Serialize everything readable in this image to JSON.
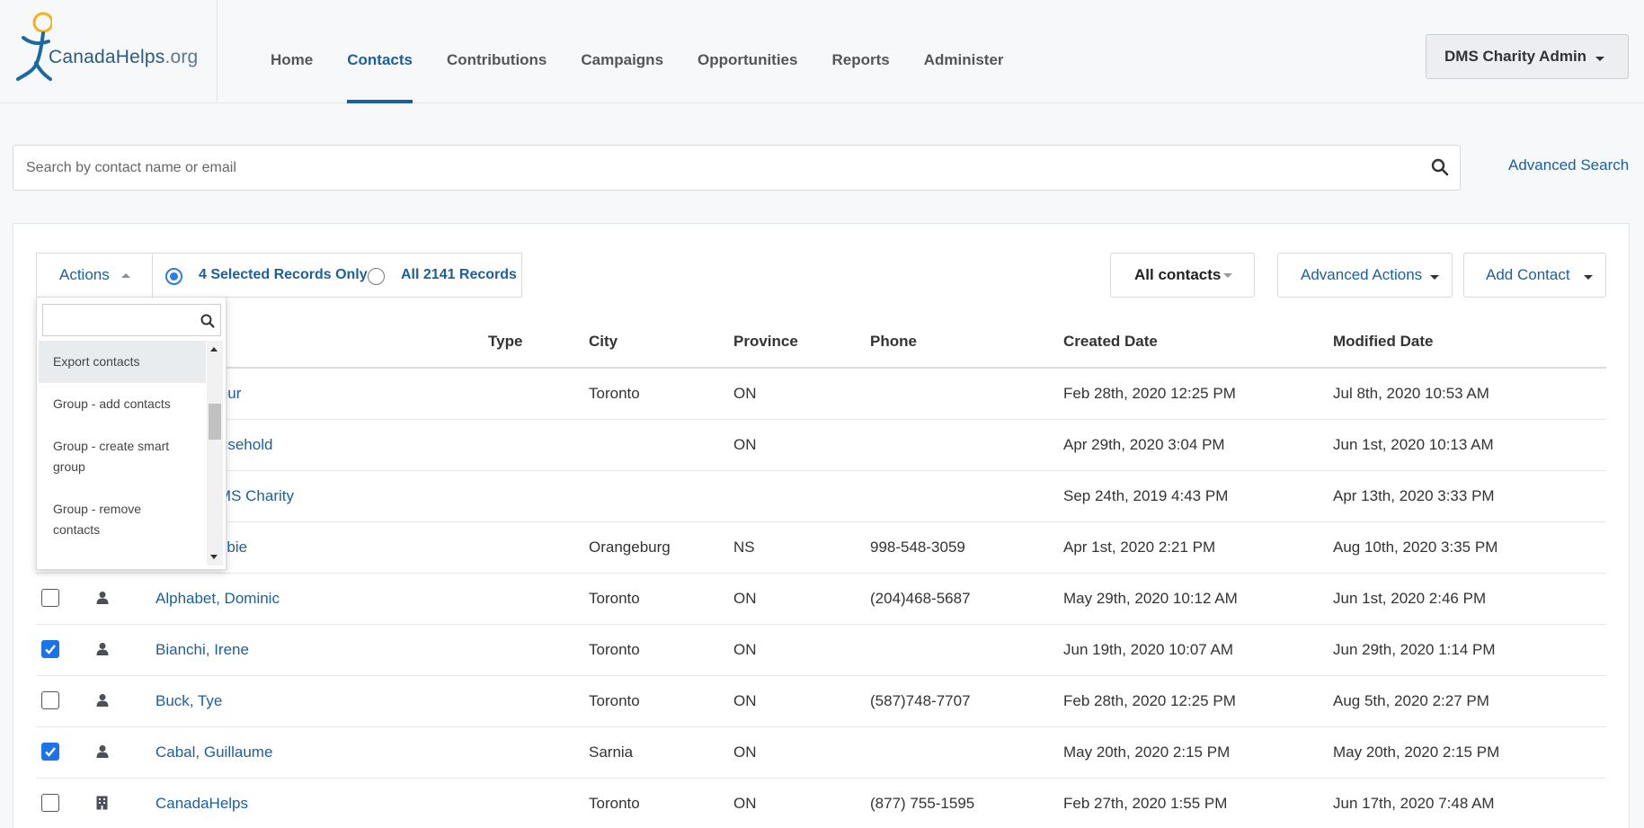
{
  "logo": {
    "text_main": "CanadaHelps",
    "text_suffix": ".org"
  },
  "nav": [
    {
      "label": "Home",
      "active": false
    },
    {
      "label": "Contacts",
      "active": true
    },
    {
      "label": "Contributions",
      "active": false
    },
    {
      "label": "Campaigns",
      "active": false
    },
    {
      "label": "Opportunities",
      "active": false
    },
    {
      "label": "Reports",
      "active": false
    },
    {
      "label": "Administer",
      "active": false
    }
  ],
  "user_menu": {
    "label": "DMS Charity Admin"
  },
  "search": {
    "placeholder": "Search by contact name or email",
    "value": "",
    "icon": "search-icon"
  },
  "advanced_search": "Advanced Search",
  "toolbar": {
    "actions_label": "Actions",
    "selected_records_label": "4 Selected Records Only",
    "all_records_label": "All 2141 Records",
    "selected_option": "selected",
    "filter_label": "All contacts",
    "advanced_actions_label": "Advanced Actions",
    "add_contact_label": "Add Contact"
  },
  "actions_dropdown": {
    "search_placeholder": "",
    "items": [
      "Export contacts",
      "Group - add contacts",
      "Group - create smart group",
      "Group - remove contacts"
    ]
  },
  "table": {
    "columns": {
      "type": "Type",
      "city": "City",
      "province": "Province",
      "phone": "Phone",
      "created": "Created Date",
      "modified": "Modified Date"
    },
    "rows": [
      {
        "checked": false,
        "type_icon": "person-icon",
        "name": "Abdul, Omur",
        "city": "Toronto",
        "province": "ON",
        "phone": "",
        "created": "Feb 28th, 2020 12:25 PM",
        "modified": "Jul 8th, 2020 10:53 AM"
      },
      {
        "checked": false,
        "type_icon": "household-icon",
        "name": "Abbot Household",
        "city": "",
        "province": "ON",
        "phone": "",
        "created": "Apr 29th, 2020 3:04 PM",
        "modified": "Jun 1st, 2020 10:13 AM"
      },
      {
        "checked": false,
        "type_icon": "organization-icon",
        "name": "Admin, DMS Charity",
        "city": "",
        "province": "",
        "phone": "",
        "created": "Sep 24th, 2019 4:43 PM",
        "modified": "Apr 13th, 2020 3:33 PM"
      },
      {
        "checked": false,
        "type_icon": "person-icon",
        "name": "Allison, Abbie",
        "city": "Orangeburg",
        "province": "NS",
        "phone": "998-548-3059",
        "created": "Apr 1st, 2020 2:21 PM",
        "modified": "Aug 10th, 2020 3:35 PM"
      },
      {
        "checked": false,
        "type_icon": "person-icon",
        "name": "Alphabet, Dominic",
        "city": "Toronto",
        "province": "ON",
        "phone": "(204)468-5687",
        "created": "May 29th, 2020 10:12 AM",
        "modified": "Jun 1st, 2020 2:46 PM"
      },
      {
        "checked": true,
        "type_icon": "person-icon",
        "name": "Bianchi, Irene",
        "city": "Toronto",
        "province": "ON",
        "phone": "",
        "created": "Jun 19th, 2020 10:07 AM",
        "modified": "Jun 29th, 2020 1:14 PM"
      },
      {
        "checked": false,
        "type_icon": "person-icon",
        "name": "Buck, Tye",
        "city": "Toronto",
        "province": "ON",
        "phone": "(587)748-7707",
        "created": "Feb 28th, 2020 12:25 PM",
        "modified": "Aug 5th, 2020 2:27 PM"
      },
      {
        "checked": true,
        "type_icon": "person-icon",
        "name": "Cabal, Guillaume",
        "city": "Sarnia",
        "province": "ON",
        "phone": "",
        "created": "May 20th, 2020 2:15 PM",
        "modified": "May 20th, 2020 2:15 PM"
      },
      {
        "checked": false,
        "type_icon": "building-icon",
        "name": "CanadaHelps",
        "city": "Toronto",
        "province": "ON",
        "phone": "(877) 755-1595",
        "created": "Feb 27th, 2020 1:55 PM",
        "modified": "Jun 17th, 2020 7:48 AM"
      }
    ]
  },
  "colors": {
    "accent": "#1d5f99",
    "checkbox": "#1a73e8",
    "logo_figure": "#1a6aa0",
    "logo_head": "#f2b21c"
  }
}
